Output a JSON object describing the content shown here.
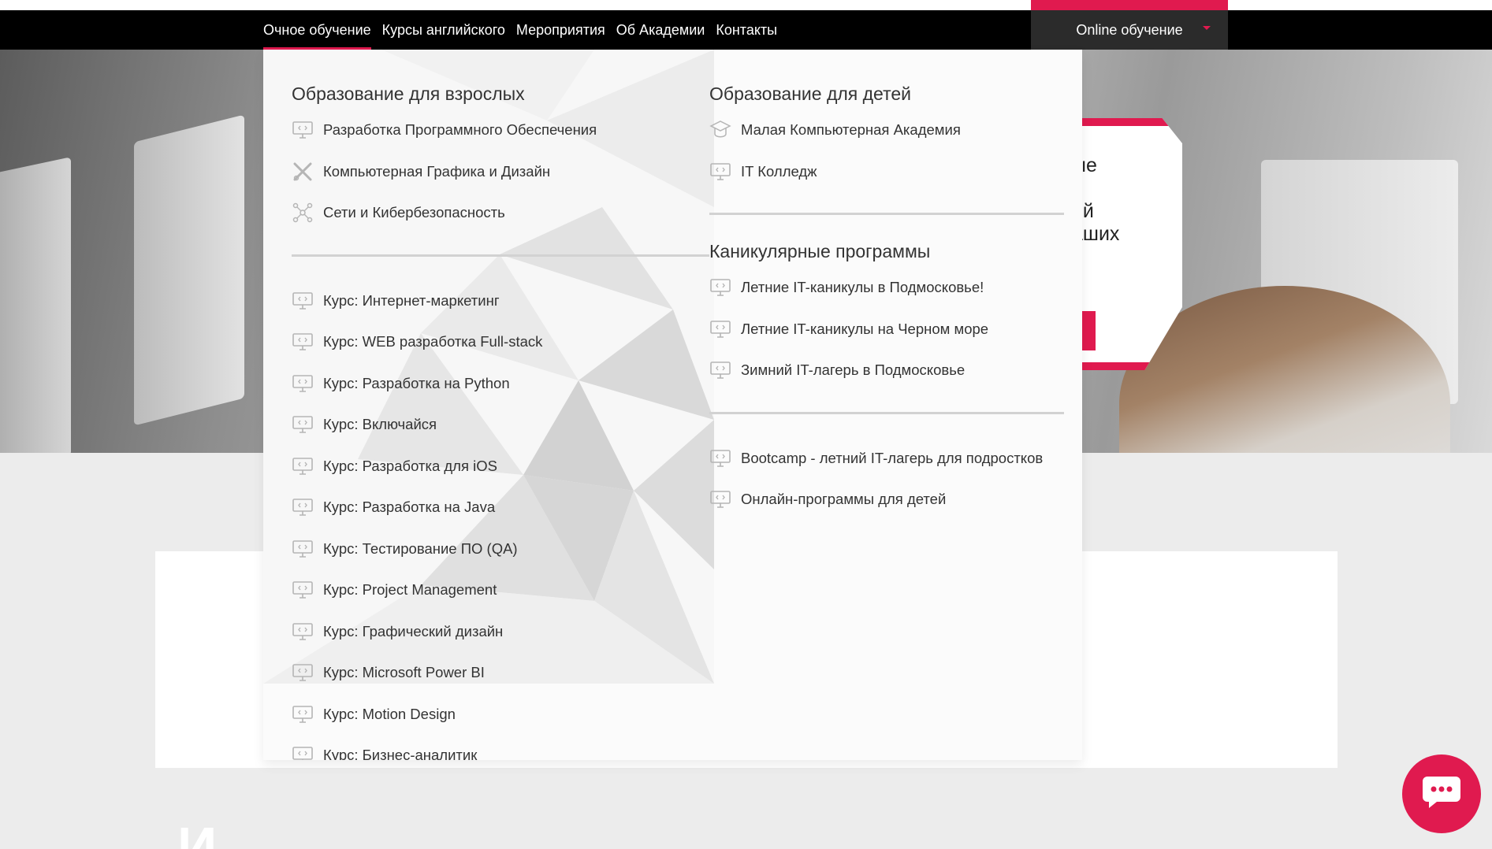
{
  "nav": {
    "items": [
      {
        "label": "Очное обучение",
        "active": true
      },
      {
        "label": "Курсы английского"
      },
      {
        "label": "Мероприятия"
      },
      {
        "label": "Об Академии"
      },
      {
        "label": "Контакты"
      }
    ],
    "online_button": "Online обучение"
  },
  "hero": {
    "card_lines": [
      "ые",
      "",
      "ой",
      "аших"
    ]
  },
  "menu": {
    "adults": {
      "heading": "Образование для взрослых",
      "primary": [
        {
          "label": "Разработка Программного Обеспечения",
          "icon": "monitor-code-icon"
        },
        {
          "label": "Компьютерная Графика и Дизайн",
          "icon": "design-tools-icon"
        },
        {
          "label": "Сети и Кибербезопасность",
          "icon": "network-icon"
        }
      ],
      "courses": [
        "Курс: Интернет-маркетинг",
        "Курс: WEB разработка Full-stack",
        "Курс: Разработка на Python",
        "Курс: Включайся",
        "Курс: Разработка для iOS",
        "Курс: Разработка на Java",
        "Курс: Тестирование ПО (QA)",
        "Курс: Project Management",
        "Курс: Графический дизайн",
        "Курс: Microsoft Power BI",
        "Курс: Motion Design",
        "Курс: Бизнес-аналитик"
      ]
    },
    "kids": {
      "heading": "Образование для детей",
      "items": [
        {
          "label": "Малая Компьютерная Академия",
          "icon": "graduation-cap-icon"
        },
        {
          "label": "IT Колледж",
          "icon": "monitor-code-icon"
        }
      ]
    },
    "holiday": {
      "heading": "Каникулярные программы",
      "items": [
        "Летние IT-каникулы в Подмосковье!",
        "Летние IT-каникулы на Черном море",
        "Зимний IT-лагерь в Подмосковье"
      ]
    },
    "extra": [
      "Bootcamp - летний IT-лагерь для подростков",
      "Онлайн-программы для детей"
    ]
  },
  "page": {
    "big_letters": "И"
  },
  "colors": {
    "accent": "#e01a4f",
    "nav_bg": "#000000",
    "menu_bg": "#fbfbfb",
    "icon": "#b5b5b5"
  },
  "icons": {
    "chat": "chat-bubble-icon",
    "caret": "caret-down-icon"
  }
}
